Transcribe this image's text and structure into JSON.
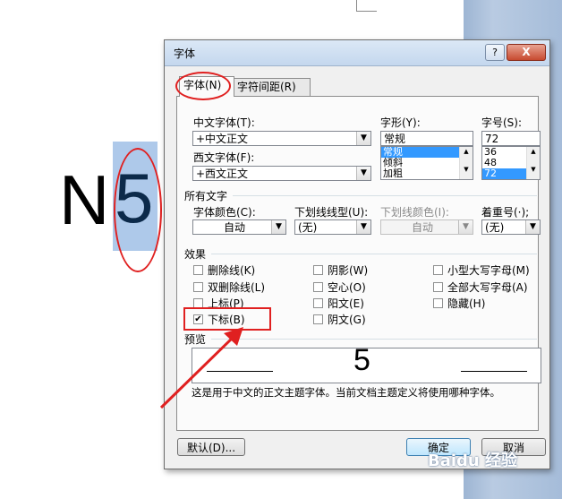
{
  "document": {
    "char_n": "N",
    "char_5": "5"
  },
  "dialog": {
    "title": "字体",
    "help": "?",
    "close": "X",
    "tabs": {
      "font": "字体(N)",
      "spacing": "字符间距(R)"
    },
    "cn_font": {
      "label": "中文字体(T):",
      "value": "+中文正文"
    },
    "west_font": {
      "label": "西文字体(F):",
      "value": "+西文正文"
    },
    "style": {
      "label": "字形(Y):",
      "value": "常规",
      "options": [
        "常规",
        "倾斜",
        "加粗"
      ]
    },
    "size": {
      "label": "字号(S):",
      "value": "72",
      "options": [
        "36",
        "48",
        "72"
      ]
    },
    "all_text": {
      "heading": "所有文字",
      "color_label": "字体颜色(C):",
      "color_value": "自动",
      "underline_label": "下划线线型(U):",
      "underline_value": "(无)",
      "underline_color_label": "下划线颜色(I):",
      "underline_color_value": "自动",
      "emphasis_label": "着重号(·);",
      "emphasis_value": "(无)"
    },
    "effects": {
      "heading": "效果",
      "items": [
        {
          "label": "删除线(K)",
          "checked": false
        },
        {
          "label": "双删除线(L)",
          "checked": false
        },
        {
          "label": "上标(P)",
          "checked": false
        },
        {
          "label": "下标(B)",
          "checked": true
        },
        {
          "label": "阴影(W)",
          "checked": false
        },
        {
          "label": "空心(O)",
          "checked": false
        },
        {
          "label": "阳文(E)",
          "checked": false
        },
        {
          "label": "阴文(G)",
          "checked": false
        },
        {
          "label": "小型大写字母(M)",
          "checked": false
        },
        {
          "label": "全部大写字母(A)",
          "checked": false
        },
        {
          "label": "隐藏(H)",
          "checked": false
        }
      ]
    },
    "preview": {
      "heading": "预览",
      "sample": "5",
      "note": "这是用于中文的正文主题字体。当前文档主题定义将使用哪种字体。"
    },
    "buttons": {
      "default": "默认(D)...",
      "ok": "确定",
      "cancel": "取消"
    }
  },
  "watermark": "Baidu 经验",
  "colors": {
    "annotation_red": "#e02020",
    "selection_blue": "#3399ff"
  }
}
